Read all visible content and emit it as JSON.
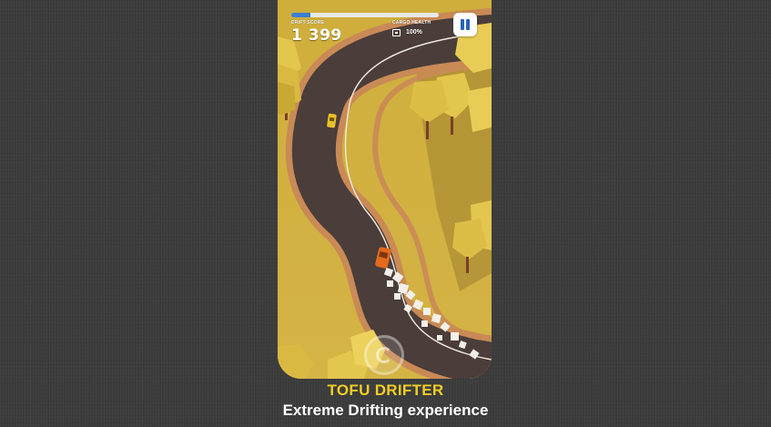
{
  "hud": {
    "score_label": "DRIFT SCORE",
    "score_value": "1 399",
    "health_label": "CARGO HEALTH",
    "health_value": "100%",
    "health_icon": "cargo-box-icon",
    "level_progress": 0.13,
    "pause_icon": "pause-icon",
    "drift_icon": "drift-control-icon"
  },
  "footer": {
    "title": "TOFU DRIFTER",
    "subtitle": "Extreme Drifting experience"
  },
  "colors": {
    "background": "#3c3c3c",
    "title": "#f2cd25",
    "subtitle": "#ffffff",
    "grass": "#c9a93a",
    "road": "#4a3d3a",
    "road_edge": "#c98a56",
    "progress": "#3c7fd6",
    "pause_button": "#ffffff",
    "pause_glyph": "#2a63b8"
  }
}
